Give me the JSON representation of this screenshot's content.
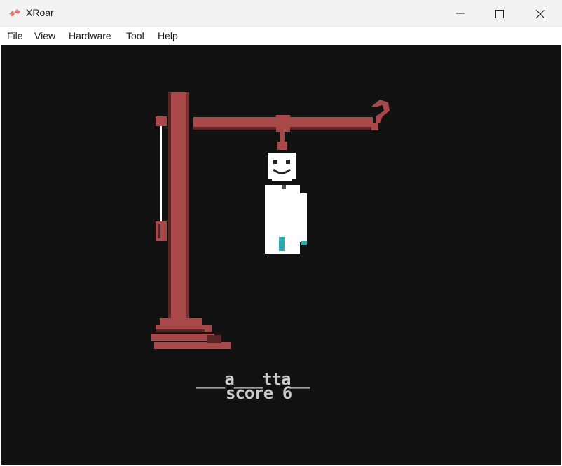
{
  "window": {
    "title": "XRoar"
  },
  "menu": [
    "File",
    "View",
    "Hardware",
    "Tool",
    "Help"
  ],
  "game": {
    "word_pattern": "___a___tta__",
    "score_label": "score 6"
  },
  "colors": {
    "gallows": "#a84848",
    "gallows_dark": "#5a2525",
    "figure": "#ffffff",
    "screen_bg": "#121212",
    "text": "#c9c9c9",
    "accent": "#2aa9b0"
  },
  "icons": {
    "app": "xroar-logo-icon",
    "minimize": "minimize-icon",
    "maximize": "maximize-icon",
    "close": "close-icon"
  }
}
